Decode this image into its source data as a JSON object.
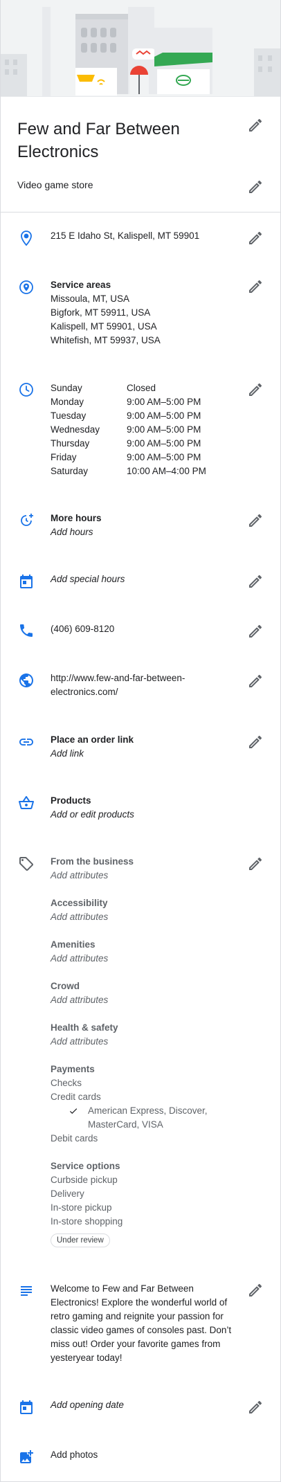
{
  "business": {
    "name": "Few and Far Between Electronics",
    "category": "Video game store",
    "address": "215 E Idaho St, Kalispell, MT 59901"
  },
  "service_areas": {
    "label": "Service areas",
    "items": [
      "Missoula, MT, USA",
      "Bigfork, MT 59911, USA",
      "Kalispell, MT 59901, USA",
      "Whitefish, MT 59937, USA"
    ]
  },
  "hours": [
    {
      "day": "Sunday",
      "time": "Closed"
    },
    {
      "day": "Monday",
      "time": "9:00 AM–5:00 PM"
    },
    {
      "day": "Tuesday",
      "time": "9:00 AM–5:00 PM"
    },
    {
      "day": "Wednesday",
      "time": "9:00 AM–5:00 PM"
    },
    {
      "day": "Thursday",
      "time": "9:00 AM–5:00 PM"
    },
    {
      "day": "Friday",
      "time": "9:00 AM–5:00 PM"
    },
    {
      "day": "Saturday",
      "time": "10:00 AM–4:00 PM"
    }
  ],
  "more_hours": {
    "label": "More hours",
    "action": "Add hours"
  },
  "special_hours": {
    "action": "Add special hours"
  },
  "phone": "(406) 609-8120",
  "website": {
    "line1": "http://www.few-and-far-between-",
    "line2": "electronics.com/"
  },
  "order_link": {
    "label": "Place an order link",
    "action": "Add link"
  },
  "products": {
    "label": "Products",
    "action": "Add or edit products"
  },
  "attributes": {
    "from_business": {
      "label": "From the business",
      "action": "Add attributes"
    },
    "accessibility": {
      "label": "Accessibility",
      "action": "Add attributes"
    },
    "amenities": {
      "label": "Amenities",
      "action": "Add attributes"
    },
    "crowd": {
      "label": "Crowd",
      "action": "Add attributes"
    },
    "health_safety": {
      "label": "Health & safety",
      "action": "Add attributes"
    },
    "payments": {
      "label": "Payments",
      "checks": "Checks",
      "credit_cards": "Credit cards",
      "card_types_line1": "American Express, Discover,",
      "card_types_line2": "MasterCard, VISA",
      "debit_cards": "Debit cards"
    },
    "service_options": {
      "label": "Service options",
      "items": [
        "Curbside pickup",
        "Delivery",
        "In-store pickup",
        "In-store shopping"
      ],
      "status": "Under review"
    }
  },
  "description": "Welcome to Few and Far Between Electronics! Explore the wonderful world of retro gaming and reignite your passion for classic video games of consoles past. Don’t miss out! Order your favorite games from yesteryear today!",
  "opening_date": {
    "action": "Add opening date"
  },
  "photos": {
    "action": "Add photos"
  },
  "colors": {
    "accent": "#1a73e8",
    "text": "#202124",
    "secondary": "#5f6368",
    "icon_grey": "#5f6368",
    "divider": "#dadce0"
  }
}
